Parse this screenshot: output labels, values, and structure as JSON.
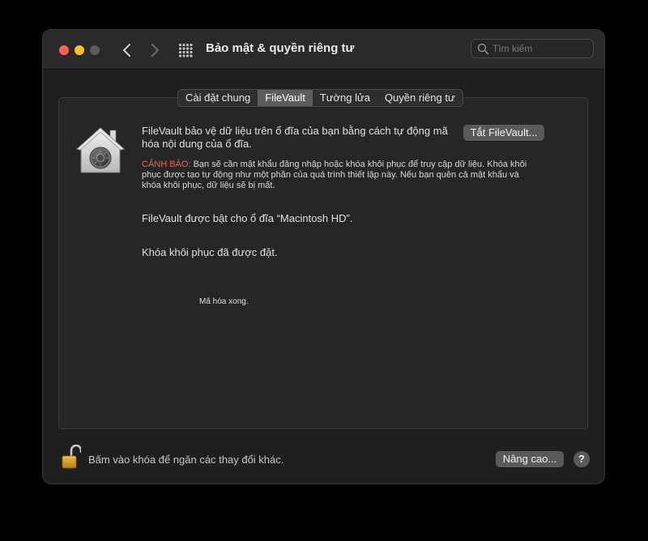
{
  "window": {
    "title": "Bảo mật & quyền riêng tư",
    "search": {
      "placeholder": "Tìm kiếm",
      "value": ""
    }
  },
  "tabs": [
    {
      "label": "Cài đặt chung",
      "active": false
    },
    {
      "label": "FileVault",
      "active": true
    },
    {
      "label": "Tường lửa",
      "active": false
    },
    {
      "label": "Quyền riêng tư",
      "active": false
    }
  ],
  "filevault": {
    "description": "FileVault bảo vệ dữ liệu trên ổ đĩa của bạn bằng cách tự động mã hóa nội dung của ổ đĩa.",
    "warning_label": "CẢNH BÁO:",
    "warning_text": " Bạn sẽ cần mật khẩu đăng nhập hoặc khóa khôi phục để truy cập dữ liệu. Khóa khôi phục được tạo tự động như một phần của quá trình thiết lập này. Nếu bạn quên cả mật khẩu và khóa khôi phục, dữ liệu sẽ bị mất.",
    "turn_off_button": "Tắt FileVault...",
    "status_enabled": "FileVault được bật cho ổ đĩa “Macintosh HD”.",
    "status_recovery": "Khóa khôi phục đã được đặt.",
    "status_encryption": "Mã hóa xong."
  },
  "footer": {
    "lock_text": "Bấm vào khóa để ngăn các thay đổi khác.",
    "advanced_button": "Nâng cao...",
    "help_button": "?"
  },
  "icons": {
    "traffic_close": "close-icon",
    "traffic_minimize": "minimize-icon",
    "traffic_zoom": "zoom-icon",
    "back": "chevron-left-icon",
    "forward": "chevron-right-icon",
    "grid": "grid-icon",
    "search": "search-icon",
    "house": "filevault-house-icon",
    "lock": "lock-open-icon"
  },
  "colors": {
    "warning": "#ff5b4f",
    "close": "#ff5f57",
    "minimize": "#febc2e"
  }
}
